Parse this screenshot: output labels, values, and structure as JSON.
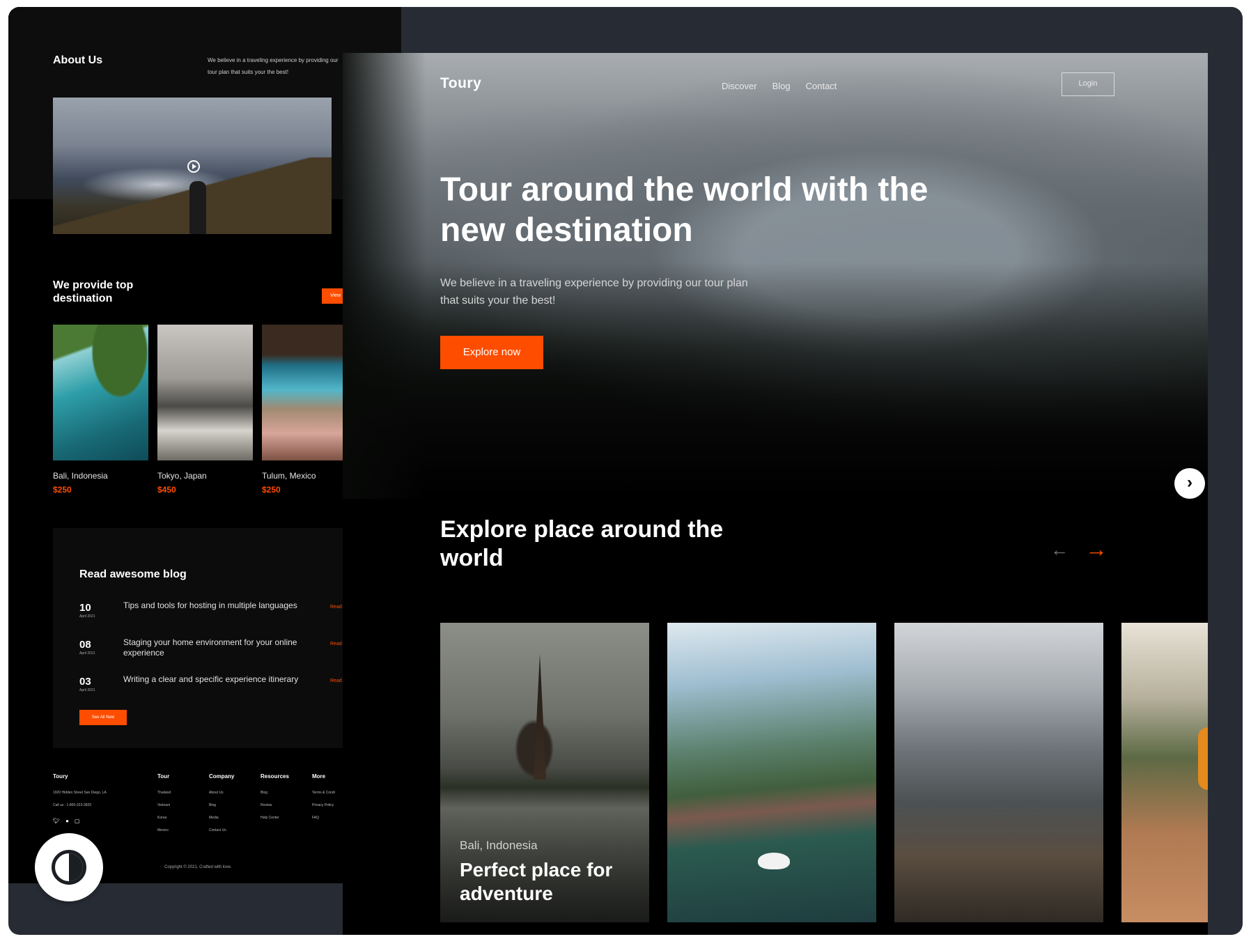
{
  "about": {
    "title": "About Us",
    "text": "We believe in a traveling experience by providing our tour plan that suits your the best!"
  },
  "destinations": {
    "title": "We provide top destination",
    "view_label": "View",
    "items": [
      {
        "name": "Bali, Indonesia",
        "price": "$250"
      },
      {
        "name": "Tokyo, Japan",
        "price": "$450"
      },
      {
        "name": "Tulum, Mexico",
        "price": "$250"
      }
    ]
  },
  "blog": {
    "title": "Read awesome blog",
    "read_label": "Read",
    "see_all_label": "See All New",
    "items": [
      {
        "day": "10",
        "month": "April 2021",
        "text": "Tips and tools for hosting in multiple languages"
      },
      {
        "day": "08",
        "month": "April 2021",
        "text": "Staging your home environment for your online experience"
      },
      {
        "day": "03",
        "month": "April 2021",
        "text": "Writing a clear and specific experience itinerary"
      }
    ]
  },
  "footer": {
    "brand": "Toury",
    "address": "1920 Hidden Street San Diego, LA",
    "phone": "Call us : 1-800-323-3829",
    "columns": [
      {
        "title": "Tour",
        "links": [
          "Thailand",
          "Vietnam",
          "Korea",
          "Mexico"
        ]
      },
      {
        "title": "Company",
        "links": [
          "About Us",
          "Blog",
          "Media",
          "Contact Us"
        ]
      },
      {
        "title": "Resources",
        "links": [
          "Blog",
          "Review",
          "Help Center"
        ]
      },
      {
        "title": "More",
        "links": [
          "Terms & Condi",
          "Privacy Policy",
          "FAQ"
        ]
      }
    ],
    "social": [
      "twitter-icon",
      "facebook-icon",
      "instagram-icon"
    ],
    "copyright": "Copyright © 2021. Crafted with love."
  },
  "hero": {
    "brand": "Toury",
    "nav": [
      "Discover",
      "Blog",
      "Contact"
    ],
    "login_label": "Login",
    "headline": "Tour around the world with the new destination",
    "subtext": "We believe in a traveling experience by providing our tour plan that suits your the best!",
    "cta_label": "Explore now"
  },
  "explore": {
    "title": "Explore place around the world",
    "cards": [
      {
        "location": "Bali, Indonesia",
        "title": "Perfect place for adventure"
      }
    ]
  },
  "colors": {
    "accent": "#ff4d00",
    "frame": "#272b33"
  }
}
